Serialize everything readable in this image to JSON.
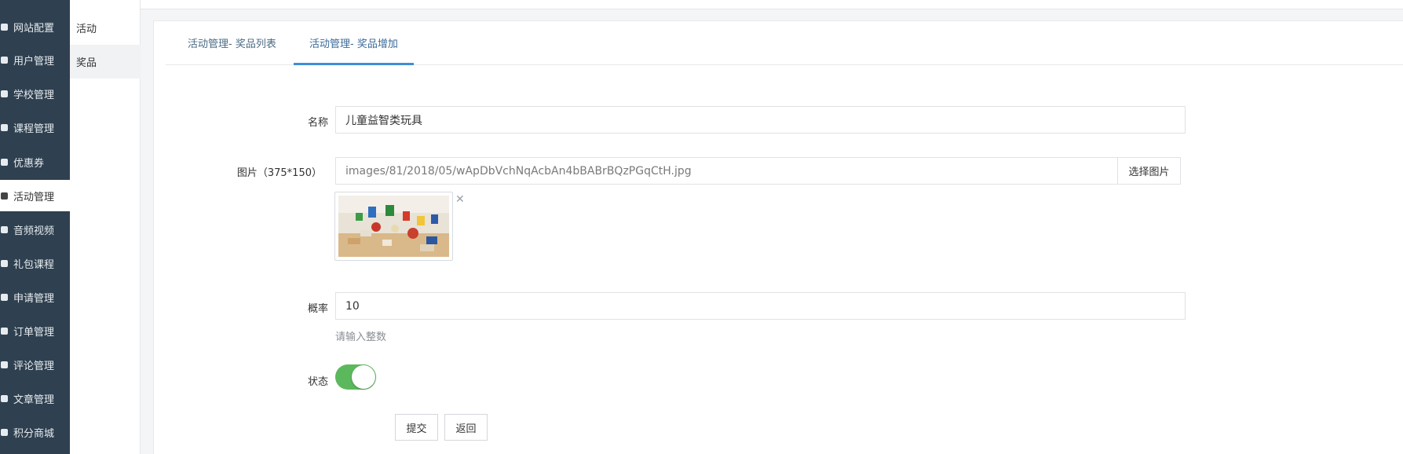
{
  "sidebar": {
    "items": [
      {
        "label": "网站配置",
        "icon": "home-icon"
      },
      {
        "label": "用户管理",
        "icon": "user-icon"
      },
      {
        "label": "学校管理",
        "icon": "server-icon"
      },
      {
        "label": "课程管理",
        "icon": "cart-icon"
      },
      {
        "label": "优惠券",
        "icon": "tag-icon"
      },
      {
        "label": "活动管理",
        "icon": "users-icon",
        "active": true
      },
      {
        "label": "音频视频",
        "icon": "anchor-icon"
      },
      {
        "label": "礼包课程",
        "icon": "gift-icon"
      },
      {
        "label": "申请管理",
        "icon": "hand-icon"
      },
      {
        "label": "订单管理",
        "icon": "thumb-icon"
      },
      {
        "label": "评论管理",
        "icon": "reply-icon"
      },
      {
        "label": "文章管理",
        "icon": "adjust-icon"
      },
      {
        "label": "积分商城",
        "icon": "shop-icon"
      }
    ]
  },
  "submenu": {
    "items": [
      {
        "label": "活动"
      },
      {
        "label": "奖品",
        "active": true
      }
    ]
  },
  "tabs": [
    {
      "label": "活动管理- 奖品列表"
    },
    {
      "label": "活动管理- 奖品增加",
      "active": true
    }
  ],
  "form": {
    "name_label": "名称",
    "name_value": "儿童益智类玩具",
    "image_label": "图片（375*150）",
    "image_path": "images/81/2018/05/wApDbVchNqAcbAn4bBABrBQzPGqCtH.jpg",
    "select_image_label": "选择图片",
    "remove_image": "✕",
    "prob_label": "概率",
    "prob_value": "10",
    "prob_help": "请输入整数",
    "status_label": "状态",
    "status_on": true,
    "submit_label": "提交",
    "back_label": "返回"
  },
  "colors": {
    "sidebar_bg": "#2f4050",
    "accent": "#3d8ed8",
    "switch_on": "#5cb85c"
  }
}
